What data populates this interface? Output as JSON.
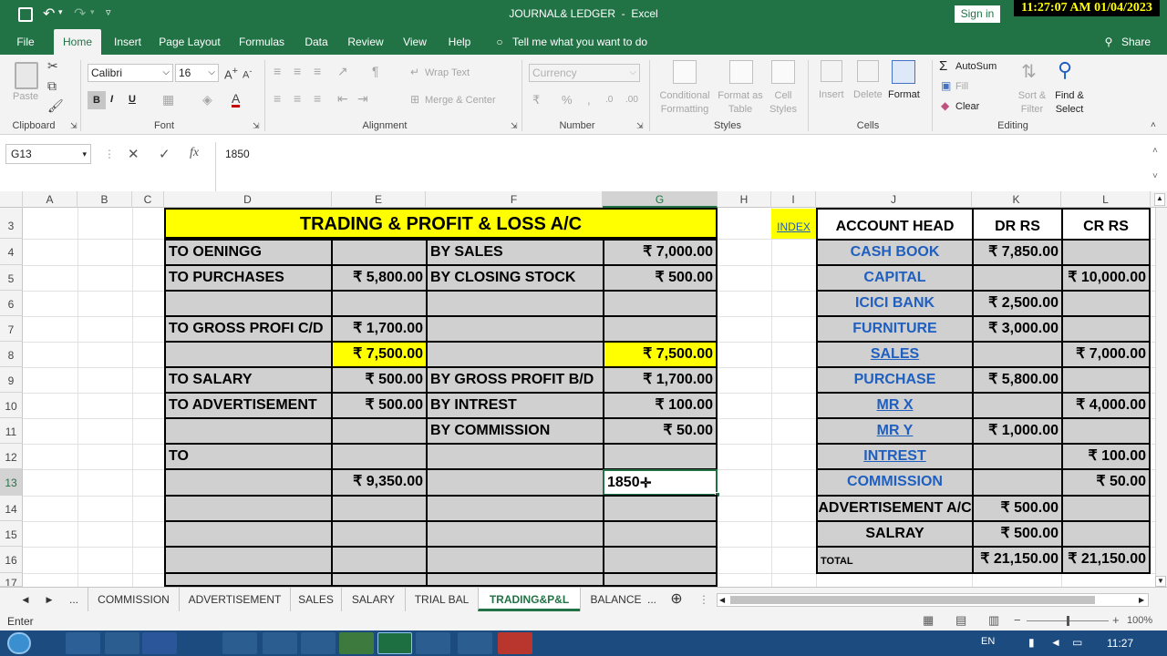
{
  "window": {
    "title": "JOURNAL& LEDGER  -  Excel",
    "signin": "Sign in",
    "clock_overlay": "11:27:07 AM 01/04/2023"
  },
  "menu": {
    "file": "File",
    "home": "Home",
    "insert": "Insert",
    "page_layout": "Page Layout",
    "formulas": "Formulas",
    "data": "Data",
    "review": "Review",
    "view": "View",
    "help": "Help",
    "tell_me": "Tell me what you want to do",
    "share": "Share"
  },
  "ribbon": {
    "clipboard": {
      "label": "Clipboard",
      "paste": "Paste"
    },
    "font": {
      "label": "Font",
      "name": "Calibri",
      "size": "16",
      "bold": "B",
      "italic": "I",
      "underline": "U"
    },
    "alignment": {
      "label": "Alignment",
      "wrap": "Wrap Text",
      "merge": "Merge & Center"
    },
    "number": {
      "label": "Number",
      "format": "Currency"
    },
    "styles": {
      "label": "Styles",
      "cond1": "Conditional",
      "cond2": "Formatting",
      "fmt1": "Format as",
      "fmt2": "Table",
      "cell1": "Cell",
      "cell2": "Styles"
    },
    "cells": {
      "label": "Cells",
      "insert": "Insert",
      "delete": "Delete",
      "format": "Format"
    },
    "editing": {
      "label": "Editing",
      "autosum": "AutoSum",
      "fill": "Fill",
      "clear": "Clear",
      "sort1": "Sort &",
      "sort2": "Filter",
      "find1": "Find &",
      "find2": "Select"
    }
  },
  "formula_bar": {
    "name_box": "G13",
    "value": "1850",
    "fx": "fx"
  },
  "columns": [
    "A",
    "B",
    "C",
    "D",
    "E",
    "F",
    "G",
    "H",
    "I",
    "J",
    "K",
    "L"
  ],
  "rows": [
    "3",
    "4",
    "5",
    "6",
    "7",
    "8",
    "9",
    "10",
    "11",
    "12",
    "13",
    "14",
    "15",
    "16",
    "17"
  ],
  "trading": {
    "title": "TRADING & PROFIT & LOSS A/C",
    "r4": {
      "d": "TO OENINGG",
      "f": "BY SALES",
      "g": "₹ 7,000.00"
    },
    "r5": {
      "d": "TO PURCHASES",
      "e": "₹ 5,800.00",
      "f": "BY CLOSING STOCK",
      "g": "₹ 500.00"
    },
    "r7": {
      "d": "TO GROSS PROFI C/D",
      "e": "₹ 1,700.00"
    },
    "r8": {
      "e": "₹ 7,500.00",
      "g": "₹ 7,500.00"
    },
    "r9": {
      "d": "TO SALARY",
      "e": "₹ 500.00",
      "f": "BY GROSS PROFIT B/D",
      "g": "₹ 1,700.00"
    },
    "r10": {
      "d": "TO ADVERTISEMENT",
      "e": "₹ 500.00",
      "f": "BY INTREST",
      "g": "₹ 100.00"
    },
    "r11": {
      "f": "BY COMMISSION",
      "g": "₹ 50.00"
    },
    "r12": {
      "d": "TO"
    },
    "r13": {
      "e": "₹ 9,350.00",
      "g": "1850"
    }
  },
  "index_link": "INDEX",
  "trial": {
    "headers": [
      "ACCOUNT HEAD",
      "DR RS",
      "CR RS"
    ],
    "rows": [
      {
        "head": "CASH BOOK",
        "dr": "₹ 7,850.00",
        "cr": ""
      },
      {
        "head": "CAPITAL",
        "dr": "",
        "cr": "₹ 10,000.00"
      },
      {
        "head": "ICICI BANK",
        "dr": "₹ 2,500.00",
        "cr": ""
      },
      {
        "head": "FURNITURE",
        "dr": "₹ 3,000.00",
        "cr": ""
      },
      {
        "head": "SALES",
        "dr": "",
        "cr": "₹ 7,000.00"
      },
      {
        "head": "PURCHASE",
        "dr": "₹ 5,800.00",
        "cr": ""
      },
      {
        "head": "MR X",
        "dr": "",
        "cr": "₹ 4,000.00"
      },
      {
        "head": "MR Y",
        "dr": "₹ 1,000.00",
        "cr": ""
      },
      {
        "head": "INTREST",
        "dr": "",
        "cr": "₹ 100.00"
      },
      {
        "head": "COMMISSION",
        "dr": "",
        "cr": "₹ 50.00"
      },
      {
        "head": "ADVERTISEMENT A/C",
        "dr": "₹ 500.00",
        "cr": ""
      },
      {
        "head": "SALRAY",
        "dr": "₹ 500.00",
        "cr": ""
      }
    ],
    "total": {
      "head": "TOTAL",
      "dr": "₹ 21,150.00",
      "cr": "₹ 21,150.00"
    }
  },
  "sheet_tabs": [
    "...",
    "COMMISSION",
    "ADVERTISEMENT",
    "SALES",
    "SALARY",
    "TRIAL BAL",
    "TRADING&P&L",
    "BALANCE",
    "..."
  ],
  "status": {
    "mode": "Enter",
    "zoom": "100%"
  },
  "taskbar": {
    "lang": "EN",
    "time": "11:27"
  }
}
